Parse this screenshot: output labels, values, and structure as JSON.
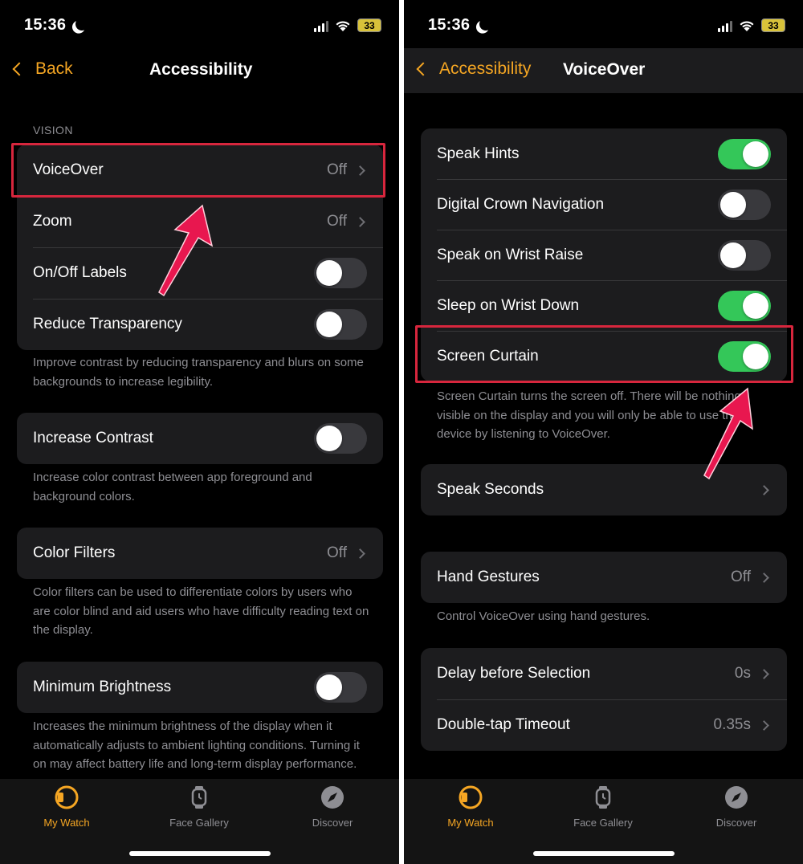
{
  "left": {
    "status": {
      "time": "15:36",
      "battery": "33"
    },
    "nav": {
      "back_label": "Back",
      "title": "Accessibility"
    },
    "vision_header": "VISION",
    "vision_rows": [
      {
        "label": "VoiceOver",
        "value": "Off"
      },
      {
        "label": "Zoom",
        "value": "Off"
      },
      {
        "label": "On/Off Labels",
        "toggle": false
      },
      {
        "label": "Reduce Transparency",
        "toggle": false
      }
    ],
    "vision_footer": "Improve contrast by reducing transparency and blurs on some backgrounds to increase legibility.",
    "increase_contrast": {
      "label": "Increase Contrast",
      "toggle": false,
      "footer": "Increase color contrast between app foreground and background colors."
    },
    "color_filters": {
      "label": "Color Filters",
      "value": "Off",
      "footer": "Color filters can be used to differentiate colors by users who are color blind and aid users who have difficulty reading text on the display."
    },
    "minimum_brightness": {
      "label": "Minimum Brightness",
      "toggle": false,
      "footer": "Increases the minimum brightness of the display when it automatically adjusts to ambient lighting conditions. Turning it on may affect battery life and long-term display performance."
    }
  },
  "right": {
    "status": {
      "time": "15:36",
      "battery": "33"
    },
    "nav": {
      "back_label": "Accessibility",
      "title": "VoiceOver"
    },
    "toggle_rows": [
      {
        "label": "Speak Hints",
        "toggle": true
      },
      {
        "label": "Digital Crown Navigation",
        "toggle": false
      },
      {
        "label": "Speak on Wrist Raise",
        "toggle": false
      },
      {
        "label": "Sleep on Wrist Down",
        "toggle": true
      },
      {
        "label": "Screen Curtain",
        "toggle": true
      }
    ],
    "screen_curtain_footer": "Screen Curtain turns the screen off. There will be nothing visible on the display and you will only be able to use the device by listening to VoiceOver.",
    "speak_seconds": {
      "label": "Speak Seconds"
    },
    "hand_gestures": {
      "label": "Hand Gestures",
      "value": "Off",
      "footer": "Control VoiceOver using hand gestures."
    },
    "timing_rows": [
      {
        "label": "Delay before Selection",
        "value": "0s"
      },
      {
        "label": "Double-tap Timeout",
        "value": "0.35s"
      }
    ]
  },
  "tabs": [
    {
      "label": "My Watch",
      "icon": "my-watch-icon",
      "active": true
    },
    {
      "label": "Face Gallery",
      "icon": "face-gallery-icon",
      "active": false
    },
    {
      "label": "Discover",
      "icon": "compass-icon",
      "active": false
    }
  ],
  "colors": {
    "accent": "#f5a623",
    "toggle_on": "#34c759",
    "highlight": "#d7263d",
    "arrow": "#e8174f"
  }
}
